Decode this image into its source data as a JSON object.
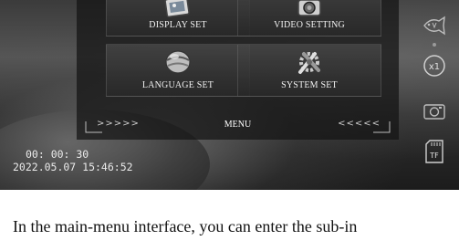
{
  "menu": {
    "tiles": [
      {
        "label": "DISPLAY SET",
        "icon": "picture-icon"
      },
      {
        "label": "VIDEO SETTING",
        "icon": "camera-icon"
      },
      {
        "label": "LANGUAGE SET",
        "icon": "globe-icon"
      },
      {
        "label": "SYSTEM SET",
        "icon": "tools-icon"
      }
    ],
    "bar_label": "MENU",
    "left_arrows": ">>>>>",
    "right_arrows": "<<<<<"
  },
  "status": {
    "elapsed": "00: 00: 30",
    "datetime": "2022.05.07   15:46:52"
  },
  "side_icons": {
    "fish_label": "",
    "zoom_label": "x1",
    "tf_label": "TF"
  },
  "caption": "In the main-menu interface, you can enter the sub-in"
}
